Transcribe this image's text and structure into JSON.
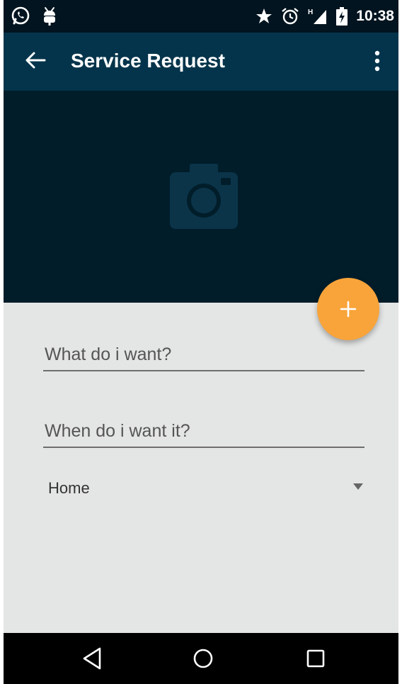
{
  "status_bar": {
    "time": "10:38",
    "left_icons": [
      "whatsapp-icon",
      "android-debug-icon"
    ],
    "right_icons": [
      "star-icon",
      "alarm-icon",
      "signal-h-icon",
      "battery-charging-icon"
    ]
  },
  "toolbar": {
    "title": "Service Request",
    "back_icon": "arrow-left-icon",
    "menu_icon": "more-vertical-icon"
  },
  "photo": {
    "icon": "camera-icon"
  },
  "fab": {
    "icon": "plus-icon",
    "color": "#f8a43a"
  },
  "form": {
    "what_placeholder": "What do i want?",
    "what_value": "",
    "when_placeholder": "When do i want it?",
    "when_value": "",
    "location_selected": "Home"
  },
  "nav_bar": {
    "icons": [
      "nav-back-icon",
      "nav-home-icon",
      "nav-recents-icon"
    ]
  },
  "colors": {
    "status_bar": "#01141f",
    "toolbar": "#04344b",
    "photo_area": "#011d2a",
    "background": "#e4e5e5",
    "accent": "#f8a43a"
  }
}
